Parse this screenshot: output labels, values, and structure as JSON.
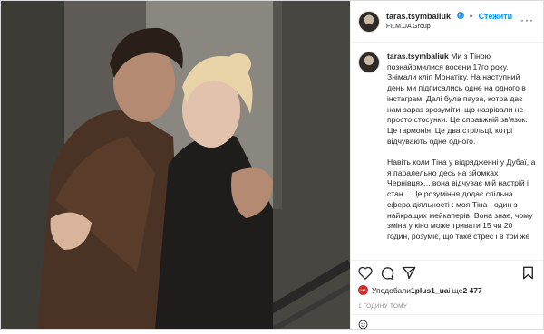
{
  "header": {
    "username": "taras.tsymbaliuk",
    "follow_label": "Стежити",
    "location": "FILM.UA Group"
  },
  "caption": {
    "username": "taras.tsymbaliuk",
    "text": "Ми з Тіною познайомилися восени 17го року. Знімали кліп Монатіку. На наступний день ми підписались одне на одного в інстаграм. Далі була пауза, котра дає нам зараз зрозуміти, що назрівали не просто стосунки. Це справжній зв'язок. Це гармонія. Це два стрільці, котрі відчувають одне одного.\n\nНавіть коли Тіна у відрядженні у Дубаї, а я паралельно десь на зйомках Чернівцях... вона відчуває мій настрій і стан... Це розуміння додає спільна сфера діяльності : моя Тіна - один з найкращих мейкаперів. Вона знає, чому зміна у кіно може тривати 15 чи 20 годин, розуміє, що таке стрес і в той же час пишається"
  },
  "likes": {
    "avatar_text": "1+1",
    "prefix": "Уподобали ",
    "user": "1plus1_ua",
    "middle": " і ще ",
    "count": "2 477"
  },
  "timestamp": "1 ГОДИНУ ТОМУ",
  "comment": {
    "placeholder": ""
  },
  "icons": {
    "more": "more-icon",
    "like": "heart-icon",
    "comment": "comment-icon",
    "share": "share-icon",
    "save": "bookmark-icon",
    "emoji": "emoji-icon"
  }
}
